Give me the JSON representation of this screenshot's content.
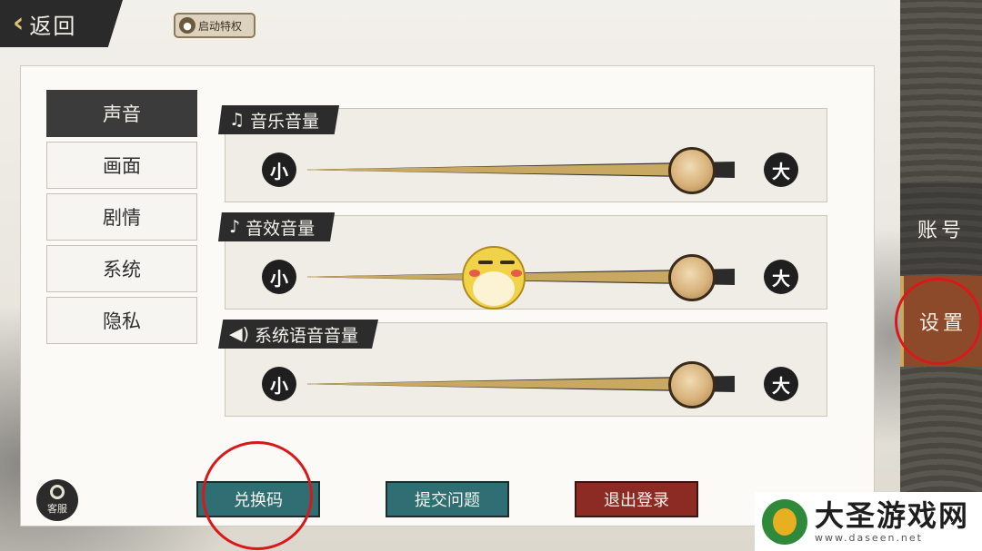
{
  "header": {
    "back_label": "返回",
    "back_icon": "chevron-left-icon",
    "wechat_label": "启动特权"
  },
  "tabs": [
    {
      "label": "声音",
      "active": true
    },
    {
      "label": "画面",
      "active": false
    },
    {
      "label": "剧情",
      "active": false
    },
    {
      "label": "系统",
      "active": false
    },
    {
      "label": "隐私",
      "active": false
    }
  ],
  "sliders": [
    {
      "title": "音乐音量",
      "icon": "music-note-icon",
      "min_label": "小",
      "max_label": "大",
      "value": 0.9
    },
    {
      "title": "音效音量",
      "icon": "eighth-note-icon",
      "min_label": "小",
      "max_label": "大",
      "value": 0.9
    },
    {
      "title": "系统语音音量",
      "icon": "speaker-icon",
      "min_label": "小",
      "max_label": "大",
      "value": 0.9
    }
  ],
  "buttons": {
    "redeem": "兑换码",
    "submit_issue": "提交问题",
    "logout": "退出登录"
  },
  "customer_service": "客服",
  "side_nav": {
    "account": "账号",
    "settings": "设置"
  },
  "watermark": {
    "title": "大圣游戏网",
    "url": "www.daseen.net"
  },
  "colors": {
    "accent_gold": "#c9a961",
    "teal_button": "#2f6e72",
    "red_button": "#8c2a24",
    "annotation_red": "#d8191a"
  }
}
